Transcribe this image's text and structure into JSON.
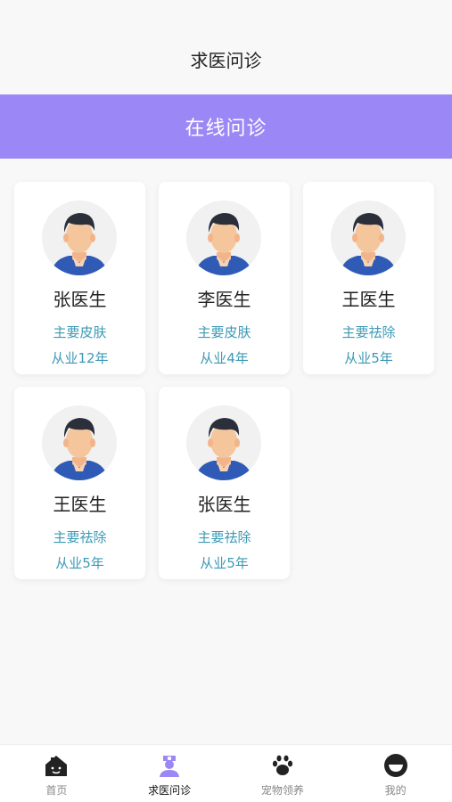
{
  "header": {
    "title": "求医问诊"
  },
  "banner": {
    "title": "在线问诊"
  },
  "doctors": [
    {
      "name": "张医生",
      "specialty": "主要皮肤",
      "experience": "从业12年"
    },
    {
      "name": "李医生",
      "specialty": "主要皮肤",
      "experience": "从业4年"
    },
    {
      "name": "王医生",
      "specialty": "主要祛除",
      "experience": "从业5年"
    },
    {
      "name": "王医生",
      "specialty": "主要祛除",
      "experience": "从业5年"
    },
    {
      "name": "张医生",
      "specialty": "主要祛除",
      "experience": "从业5年"
    }
  ],
  "tabbar": {
    "items": [
      {
        "label": "首页",
        "icon": "home-icon"
      },
      {
        "label": "求医问诊",
        "icon": "nurse-icon"
      },
      {
        "label": "宠物领养",
        "icon": "paw-icon"
      },
      {
        "label": "我的",
        "icon": "smile-icon"
      }
    ],
    "active_index": 1
  },
  "colors": {
    "banner": "#9b87f5",
    "accent_text": "#3c9ab5",
    "active_icon": "#9b87f5"
  }
}
